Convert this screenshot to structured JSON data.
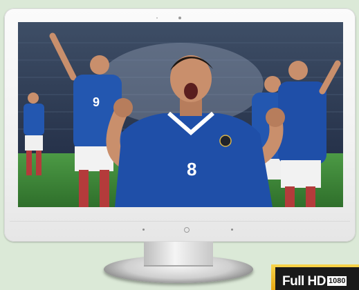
{
  "player": {
    "jersey_number": "8"
  },
  "background_players": [
    {
      "jersey_number": "9"
    },
    {
      "jersey_number": ""
    }
  ],
  "badge": {
    "label": "Full HD",
    "resolution": "1080"
  },
  "colors": {
    "background": "#dbe9d7",
    "jersey": "#1f4fa8",
    "pitch": "#3f8a3a",
    "badge": "#f0b92a"
  },
  "icons": [
    "webcam-icon",
    "power-button-icon",
    "brand-logo-icon"
  ]
}
